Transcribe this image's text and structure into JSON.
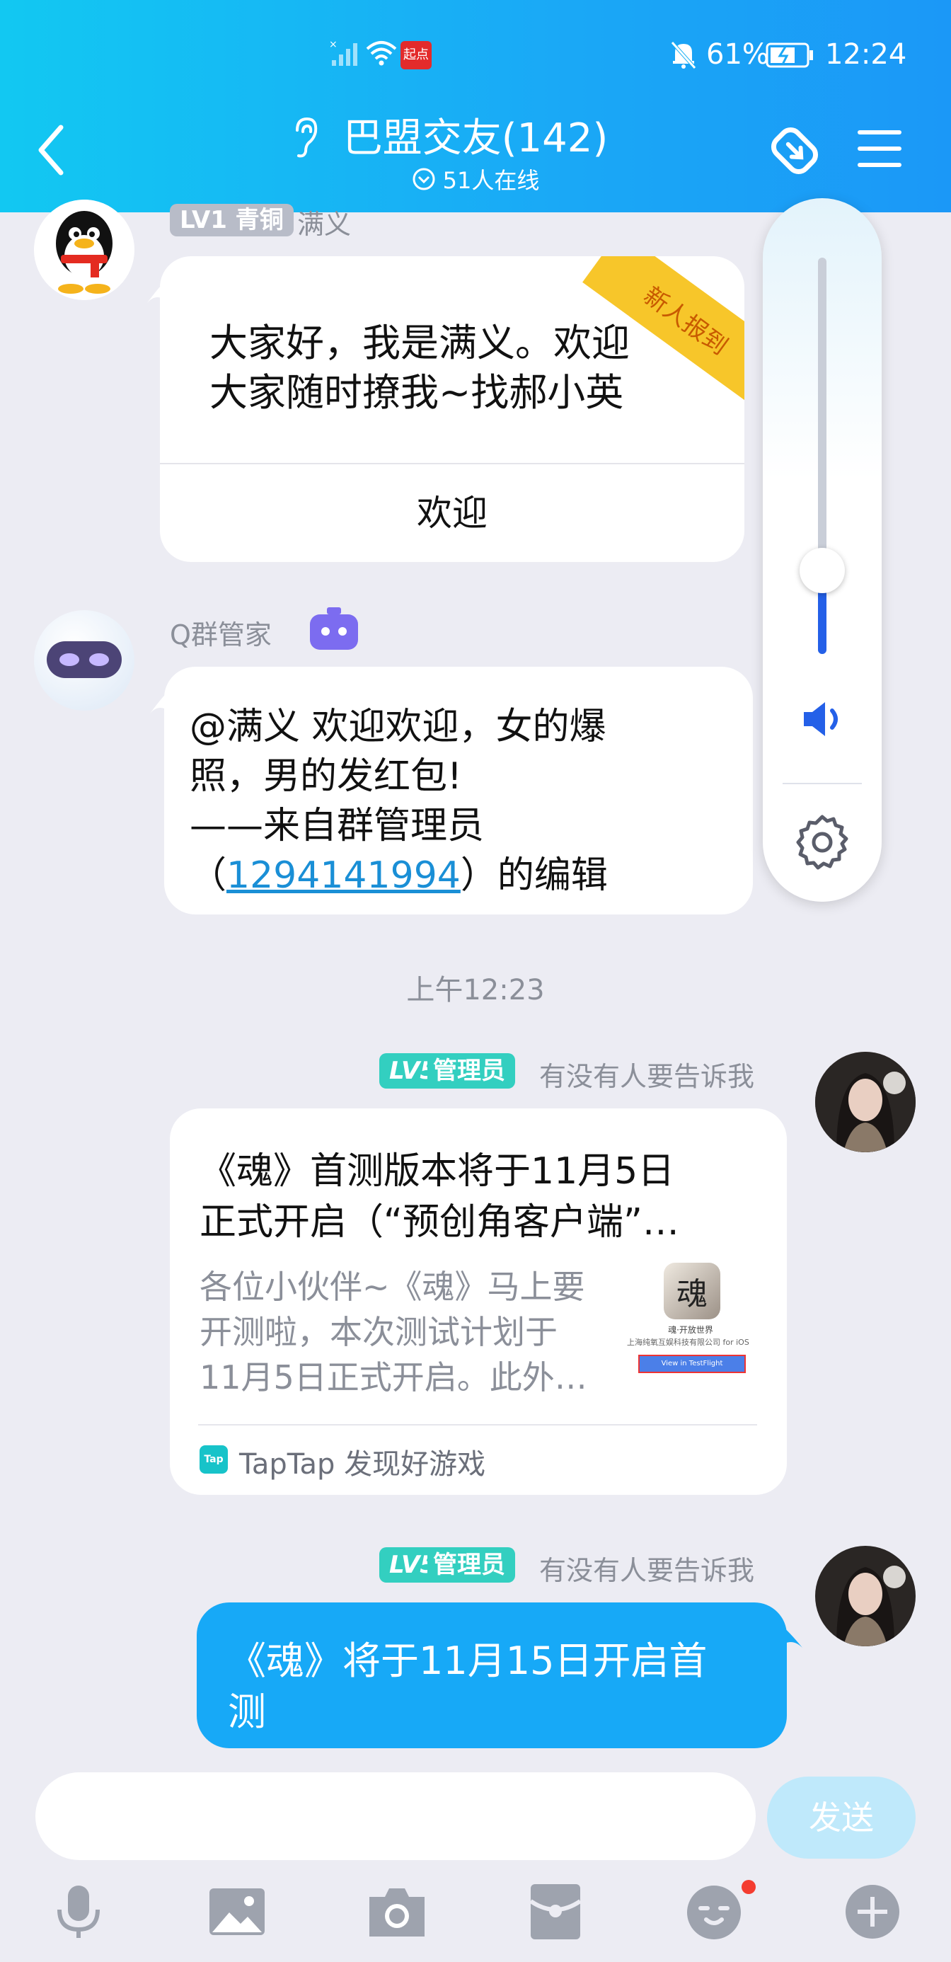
{
  "status_bar": {
    "carrier_badge": "起点",
    "battery": "61%",
    "time": "12:24"
  },
  "header": {
    "title": "巴盟交友(142)",
    "online": "51人在线"
  },
  "messages": {
    "m1": {
      "nick": "满义",
      "level_badge": "LV1 青铜",
      "corner_tag": "新人报到",
      "line1": "大家好，我是满义。欢迎",
      "line2": "大家随时撩我~找郝小英",
      "action": "欢迎"
    },
    "m2": {
      "nick": "Q群管家",
      "line1": "@满义 欢迎欢迎，女的爆",
      "line2": "照，男的发红包!",
      "line3": "——来自群管理员",
      "line4_pre": "（",
      "line4_link": "1294141994",
      "line4_post": "）的编辑"
    },
    "timestamp": "上午12:23",
    "m3": {
      "level": "LV5",
      "role": "管理员",
      "nick": "有没有人要告诉我",
      "card_title1": "《魂》首测版本将于11月5日",
      "card_title2": "正式开启（“预创角客户端”…",
      "card_desc1": "各位小伙伴~《魂》马上要",
      "card_desc2": "开测啦，本次测试计划于",
      "card_desc3": "11月5日正式开启。此外…",
      "thumb_line1": "魂·开放世界",
      "thumb_line2": "上海纯氧互娱科技有限公司 for iOS",
      "thumb_button": "View in TestFlight",
      "source": "TapTap 发现好游戏",
      "source_logo": "Tap"
    },
    "m4": {
      "level": "LV5",
      "role": "管理员",
      "nick": "有没有人要告诉我",
      "line1": "《魂》将于11月15日开启首",
      "line2": "测"
    }
  },
  "input": {
    "send_label": "发送"
  },
  "colors": {
    "header_start": "#12c8f2",
    "header_end": "#1b98f7",
    "bubble_blue": "#17a9f7",
    "badge_teal": "#33cfc0",
    "link_blue": "#1a8fd6",
    "volume_blue": "#2460e8"
  },
  "toolbar_icons": [
    "microphone-icon",
    "image-icon",
    "camera-icon",
    "red-packet-icon",
    "emoji-icon",
    "plus-icon"
  ]
}
